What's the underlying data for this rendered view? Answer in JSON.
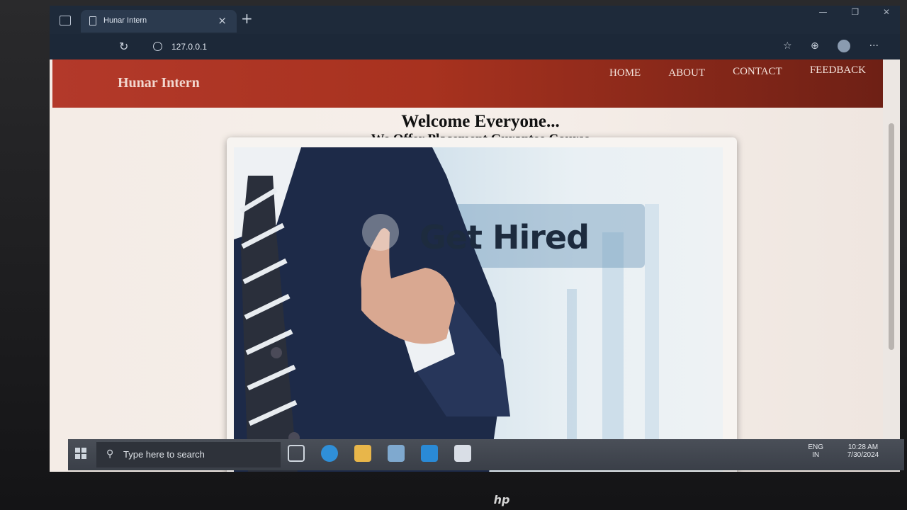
{
  "browser": {
    "tab_title": "Hunar Intern",
    "url": "127.0.0.1"
  },
  "site": {
    "brand": "Hunar Intern",
    "nav": [
      "HOME",
      "ABOUT",
      "CONTACT",
      "FEEDBACK"
    ],
    "heading": "Welcome Everyone...",
    "subheading": "We Offer Placement Gurantee Course",
    "hero_text": "Get Hired"
  },
  "taskbar": {
    "search_placeholder": "Type here to search",
    "lang_1": "ENG",
    "lang_2": "IN",
    "time": "10:28 AM",
    "date": "7/30/2024",
    "icons": [
      "task-view-icon",
      "edge-icon",
      "file-explorer-icon",
      "mail-icon",
      "vscode-icon",
      "document-icon"
    ]
  },
  "hardware": {
    "logo": "hp"
  }
}
